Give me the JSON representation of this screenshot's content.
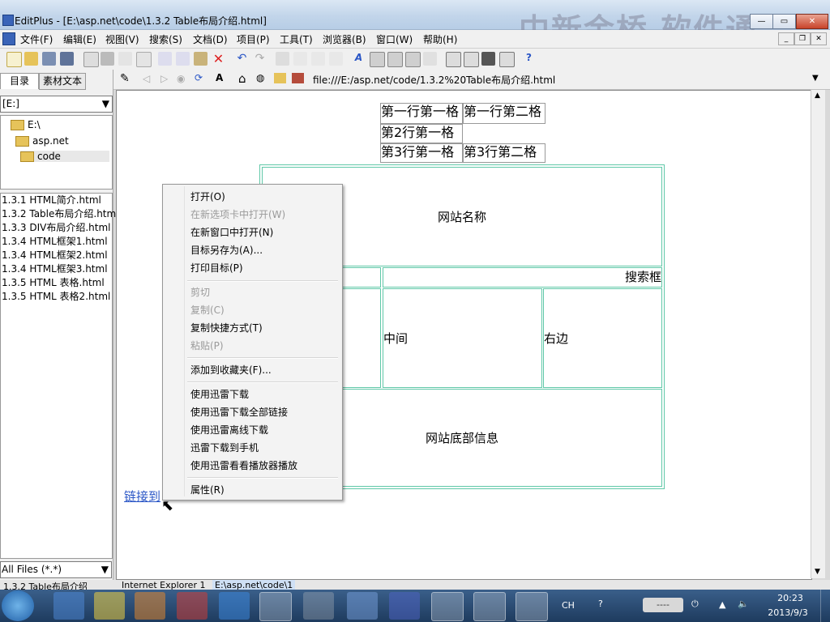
{
  "window": {
    "title": "EditPlus - [E:\\asp.net\\code\\1.3.2 Table布局介绍.html]",
    "watermark": "中新金桥 软件通"
  },
  "menubar": [
    "文件(F)",
    "编辑(E)",
    "视图(V)",
    "搜索(S)",
    "文档(D)",
    "项目(P)",
    "工具(T)",
    "浏览器(B)",
    "窗口(W)",
    "帮助(H)"
  ],
  "left_panel": {
    "tabs": [
      "目录",
      "素材文本"
    ],
    "drive": "[E:]",
    "tree": [
      "E:\\",
      "asp.net",
      "code"
    ],
    "files": [
      "1.3.1 HTML简介.html",
      "1.3.2 Table布局介绍.htm",
      "1.3.3 DIV布局介绍.html",
      "1.3.4 HTML框架1.html",
      "1.3.4 HTML框架2.html",
      "1.3.4 HTML框架3.html",
      "1.3.5 HTML 表格.html",
      "1.3.5 HTML 表格2.html"
    ],
    "filter": "All Files (*.*)"
  },
  "browser": {
    "url": "file:///E:/asp.net/code/1.3.2%20Table布局介绍.html"
  },
  "page": {
    "small_table": {
      "r1c1": "第一行第一格",
      "r1c2": "第一行第二格",
      "r2c1": "第2行第一格",
      "r3c1": "第3行第一格",
      "r3c2": "第3行第二格"
    },
    "layout": {
      "header": "网站名称",
      "search": "搜索框",
      "middle": "中间",
      "right": "右边",
      "footer": "网站底部信息"
    },
    "link": "链接到"
  },
  "context_menu": {
    "open": "打开(O)",
    "open_new_tab": "在新选项卡中打开(W)",
    "open_new_window": "在新窗口中打开(N)",
    "save_target_as": "目标另存为(A)...",
    "print_target": "打印目标(P)",
    "cut": "剪切",
    "copy": "复制(C)",
    "copy_shortcut": "复制快捷方式(T)",
    "paste": "粘贴(P)",
    "add_favorites": "添加到收藏夹(F)...",
    "thunder_download": "使用迅雷下载",
    "thunder_download_all": "使用迅雷下载全部链接",
    "thunder_offline": "使用迅雷离线下载",
    "thunder_phone": "迅雷下载到手机",
    "thunder_player": "使用迅雷看看播放器播放",
    "properties": "属性(R)"
  },
  "doc_tabs": [
    "1.3.2 Table布局介绍",
    "Internet Explorer 1",
    "E:\\asp.net\\code\\1"
  ],
  "taskbar": {
    "lang": "CH",
    "tray_box": "----",
    "time": "20:23",
    "date": "2013/9/3"
  }
}
